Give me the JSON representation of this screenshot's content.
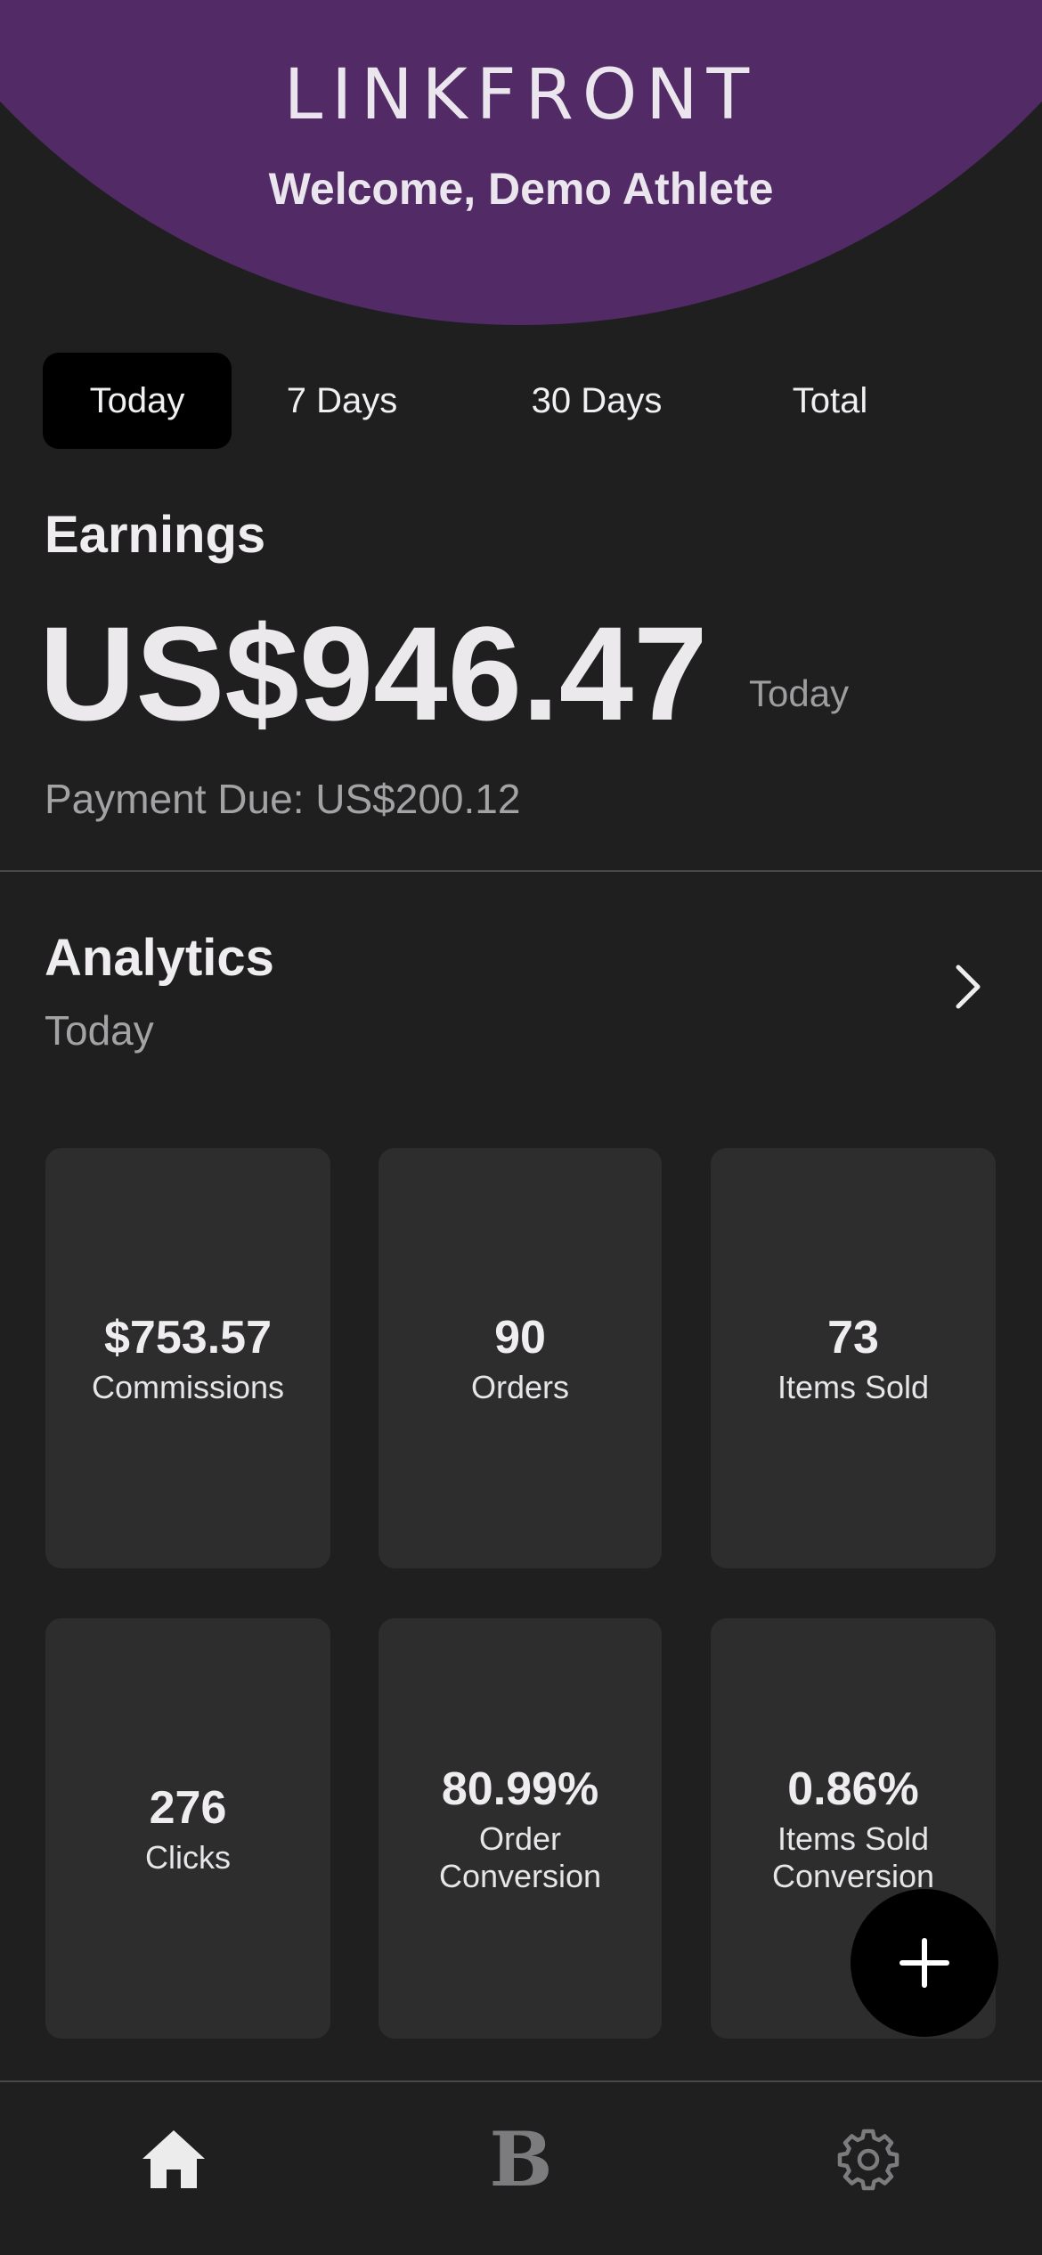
{
  "header": {
    "brand": "LINKFRONT",
    "welcome": "Welcome, Demo Athlete",
    "background_color": "#512a66"
  },
  "tabs": [
    {
      "label": "Today",
      "active": true
    },
    {
      "label": "7 Days",
      "active": false
    },
    {
      "label": "30 Days",
      "active": false
    },
    {
      "label": "Total",
      "active": false
    }
  ],
  "earnings": {
    "title": "Earnings",
    "amount": "US$946.47",
    "period": "Today",
    "payment_due": "Payment Due: US$200.12"
  },
  "analytics": {
    "title": "Analytics",
    "period": "Today",
    "chevron_icon": "chevron-right-icon",
    "cards": [
      {
        "value": "$753.57",
        "label": "Commissions"
      },
      {
        "value": "90",
        "label": "Orders"
      },
      {
        "value": "73",
        "label": "Items Sold"
      },
      {
        "value": "276",
        "label": "Clicks"
      },
      {
        "value": "80.99%",
        "label": "Order Conversion"
      },
      {
        "value": "0.86%",
        "label": "Items Sold Conversion"
      }
    ]
  },
  "fab": {
    "icon": "plus-icon"
  },
  "bottom_nav": [
    {
      "icon": "home-icon",
      "active": true
    },
    {
      "icon": "brand-b-icon",
      "glyph": "B",
      "active": false
    },
    {
      "icon": "gear-icon",
      "active": false
    }
  ],
  "colors": {
    "background": "#1f1f20",
    "card": "#2d2d2e",
    "accent_purple": "#512a66"
  }
}
